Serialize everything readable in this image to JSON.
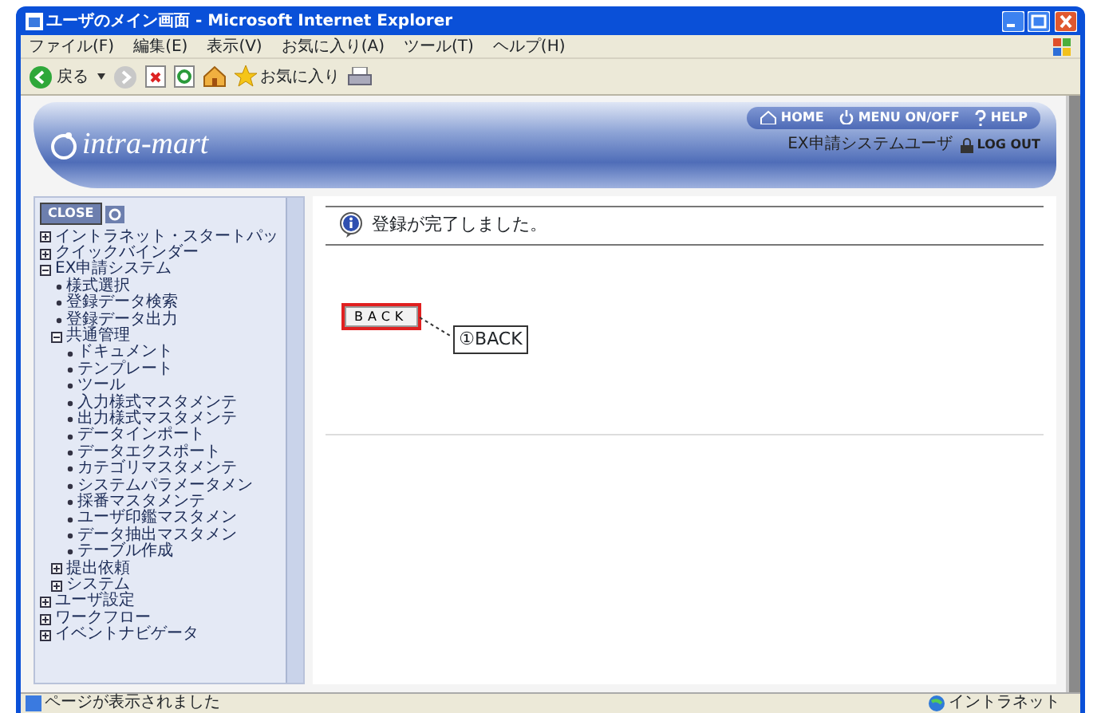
{
  "window": {
    "title": "ユーザのメイン画面 - Microsoft Internet Explorer"
  },
  "menu_bar": [
    "ファイル(F)",
    "編集(E)",
    "表示(V)",
    "お気に入り(A)",
    "ツール(T)",
    "ヘルプ(H)"
  ],
  "toolbar": {
    "back_label": "戻る",
    "favorites_label": "お気に入り"
  },
  "header": {
    "logo": "intra-mart",
    "links": [
      {
        "kind": "home",
        "label": "HOME"
      },
      {
        "kind": "power",
        "label": "MENU ON/OFF"
      },
      {
        "kind": "help",
        "label": "HELP"
      }
    ],
    "user": "EX申請システムユーザ",
    "logout": "LOG OUT"
  },
  "sidebar": {
    "close_label": "CLOSE",
    "items": [
      {
        "kind": "folder",
        "label": "イントラネット・スタートパッ",
        "expanded": false
      },
      {
        "kind": "folder",
        "label": "クイックバインダー",
        "expanded": false
      },
      {
        "kind": "folder",
        "label": "EX申請システム",
        "expanded": true,
        "children": [
          {
            "kind": "leaf",
            "label": "様式選択"
          },
          {
            "kind": "leaf",
            "label": "登録データ検索"
          },
          {
            "kind": "leaf",
            "label": "登録データ出力"
          },
          {
            "kind": "folder",
            "label": "共通管理",
            "expanded": true,
            "children": [
              {
                "kind": "leaf",
                "label": "ドキュメント"
              },
              {
                "kind": "leaf",
                "label": "テンプレート"
              },
              {
                "kind": "leaf",
                "label": "ツール"
              },
              {
                "kind": "leaf",
                "label": "入力様式マスタメンテ"
              },
              {
                "kind": "leaf",
                "label": "出力様式マスタメンテ"
              },
              {
                "kind": "leaf",
                "label": "データインポート"
              },
              {
                "kind": "leaf",
                "label": "データエクスポート"
              },
              {
                "kind": "leaf",
                "label": "カテゴリマスタメンテ"
              },
              {
                "kind": "leaf",
                "label": "システムパラメータメン"
              },
              {
                "kind": "leaf",
                "label": "採番マスタメンテ"
              },
              {
                "kind": "leaf",
                "label": "ユーザ印鑑マスタメン"
              },
              {
                "kind": "leaf",
                "label": "データ抽出マスタメン"
              },
              {
                "kind": "leaf",
                "label": "テーブル作成"
              }
            ]
          },
          {
            "kind": "folder",
            "label": "提出依頼",
            "expanded": false
          },
          {
            "kind": "folder",
            "label": "システム",
            "expanded": false
          }
        ]
      },
      {
        "kind": "folder",
        "label": "ユーザ設定",
        "expanded": false
      },
      {
        "kind": "folder",
        "label": "ワークフロー",
        "expanded": false
      },
      {
        "kind": "folder",
        "label": "イベントナビゲータ",
        "expanded": false
      }
    ]
  },
  "main": {
    "message": "登録が完了しました。",
    "back_button": "BACK",
    "callout": "①BACK"
  },
  "status_bar": {
    "text": "ページが表示されました",
    "zone": "イントラネット"
  }
}
